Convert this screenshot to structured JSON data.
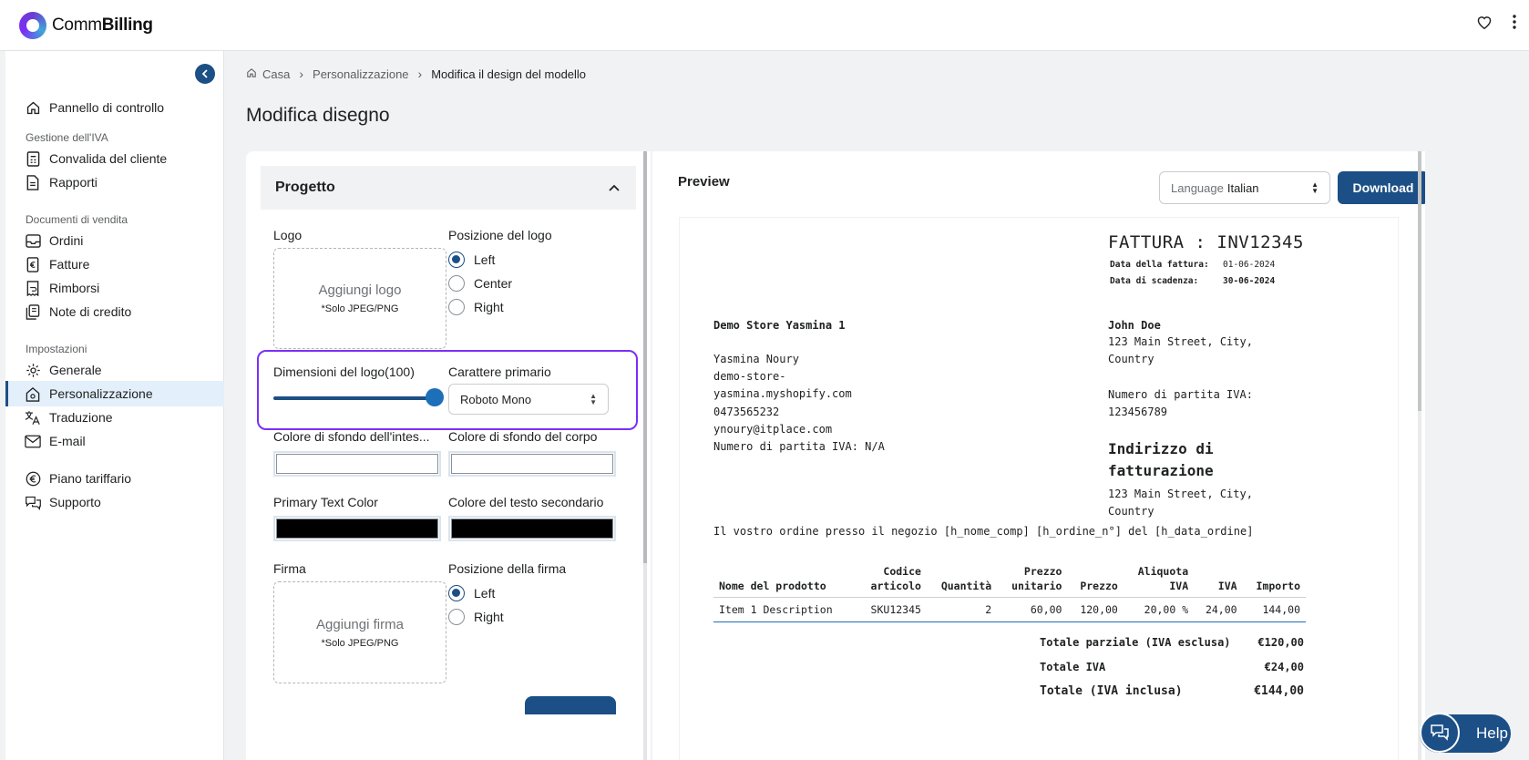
{
  "app": {
    "name_light": "Comm",
    "name_bold": "Billing"
  },
  "breadcrumb": {
    "home": "Casa",
    "level1": "Personalizzazione",
    "current": "Modifica il design del modello"
  },
  "page_title": "Modifica disegno",
  "sidebar": {
    "dashboard": "Pannello di controllo",
    "section_vat": "Gestione dell'IVA",
    "customer_validation": "Convalida del cliente",
    "reports": "Rapporti",
    "section_sales": "Documenti di vendita",
    "orders": "Ordini",
    "invoices": "Fatture",
    "refunds": "Rimborsi",
    "credit_notes": "Note di credito",
    "section_settings": "Impostazioni",
    "general": "Generale",
    "customization": "Personalizzazione",
    "translation": "Traduzione",
    "email": "E-mail",
    "plan": "Piano tariffario",
    "support": "Supporto"
  },
  "editor": {
    "section_title": "Progetto",
    "logo_label": "Logo",
    "logo_add": "Aggiungi logo",
    "logo_hint": "*Solo JPEG/PNG",
    "logo_position_label": "Posizione del logo",
    "logo_positions": [
      "Left",
      "Center",
      "Right"
    ],
    "logo_position_selected": "Left",
    "logo_size_label": "Dimensioni del logo(100)",
    "logo_size_value": 100,
    "primary_font_label": "Carattere primario",
    "primary_font_value": "Roboto Mono",
    "header_bg_label": "Colore di sfondo dell'intes...",
    "body_bg_label": "Colore di sfondo del corpo",
    "header_bg_color": "#ffffff",
    "body_bg_color": "#ffffff",
    "primary_text_label": "Primary Text Color",
    "secondary_text_label": "Colore del testo secondario",
    "primary_text_color": "#000000",
    "secondary_text_color": "#000000",
    "signature_label": "Firma",
    "signature_add": "Aggiungi firma",
    "signature_hint": "*Solo JPEG/PNG",
    "signature_position_label": "Posizione della firma",
    "signature_positions": [
      "Left",
      "Right"
    ],
    "signature_position_selected": "Left"
  },
  "preview": {
    "title": "Preview",
    "language_key": "Language",
    "language_value": "Italian",
    "download": "Download"
  },
  "invoice": {
    "title": "FATTURA : INV12345",
    "date_label": "Data della fattura:",
    "date_value": "01-06-2024",
    "due_label": "Data di scadenza:",
    "due_value": "30-06-2024",
    "store_name": "Demo Store Yasmina 1",
    "store_lines": [
      "Yasmina Noury",
      "demo-store-",
      "yasmina.myshopify.com",
      "0473565232",
      "ynoury@itplace.com",
      "Numero di partita IVA: N/A"
    ],
    "customer_name": "John Doe",
    "customer_lines": [
      "123 Main Street, City,",
      "Country",
      "",
      "Numero di partita IVA:",
      "123456789"
    ],
    "billing_heading": "Indirizzo di fatturazione",
    "billing_lines": [
      "123 Main Street, City,",
      "Country"
    ],
    "order_sentence": "Il vostro ordine presso il negozio [h_nome_comp] [h_ordine_n°] del [h_data_ordine]",
    "table_headers": [
      [
        "Nome del prodotto"
      ],
      [
        "Codice",
        "articolo"
      ],
      [
        "Quantità"
      ],
      [
        "Prezzo",
        "unitario"
      ],
      [
        "Prezzo"
      ],
      [
        "Aliquota",
        "IVA"
      ],
      [
        "IVA"
      ],
      [
        "Importo"
      ]
    ],
    "rows": [
      [
        "Item 1 Description",
        "SKU12345",
        "2",
        "60,00",
        "120,00",
        "20,00 %",
        "24,00",
        "144,00"
      ]
    ],
    "subtotal_label": "Totale parziale (IVA esclusa)",
    "subtotal_value": "€120,00",
    "vat_total_label": "Totale IVA",
    "vat_total_value": "€24,00",
    "grand_total_label": "Totale (IVA inclusa)",
    "grand_total_value": "€144,00"
  },
  "help": {
    "label": "Help"
  },
  "colors": {
    "accent": "#1c4f86",
    "highlight": "#7b2ff7"
  }
}
